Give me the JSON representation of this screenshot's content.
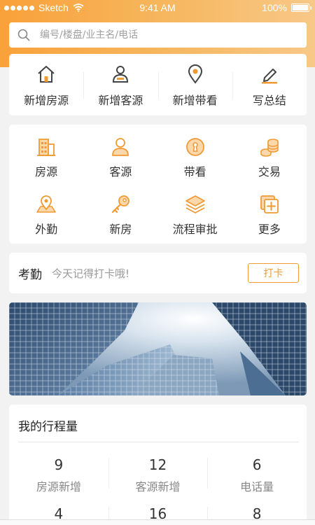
{
  "status_bar": {
    "carrier": "Sketch",
    "time": "9:41 AM",
    "battery": "100%"
  },
  "search": {
    "placeholder": "编号/楼盘/业主名/电话"
  },
  "quick_actions": [
    {
      "label": "新增房源",
      "icon": "house-icon"
    },
    {
      "label": "新增客源",
      "icon": "user-card-icon"
    },
    {
      "label": "新增带看",
      "icon": "location-pin-icon"
    },
    {
      "label": "写总结",
      "icon": "pencil-icon"
    }
  ],
  "grid": [
    {
      "label": "房源",
      "icon": "building-icon"
    },
    {
      "label": "客源",
      "icon": "person-icon"
    },
    {
      "label": "带看",
      "icon": "keyhole-icon"
    },
    {
      "label": "交易",
      "icon": "coins-icon"
    },
    {
      "label": "外勤",
      "icon": "map-pin-icon"
    },
    {
      "label": "新房",
      "icon": "key-icon"
    },
    {
      "label": "流程审批",
      "icon": "layers-icon"
    },
    {
      "label": "更多",
      "icon": "more-plus-icon"
    }
  ],
  "attendance": {
    "title": "考勤",
    "tip": "今天记得打卡哦!",
    "button": "打卡"
  },
  "itinerary": {
    "title": "我的行程量",
    "stats": [
      {
        "value": "9",
        "label": "房源新增"
      },
      {
        "value": "12",
        "label": "客源新增"
      },
      {
        "value": "6",
        "label": "电话量"
      },
      {
        "value": "4",
        "label": ""
      },
      {
        "value": "16",
        "label": ""
      },
      {
        "value": "8",
        "label": ""
      }
    ]
  },
  "colors": {
    "accent": "#f09a33",
    "header_start": "#f9a13a",
    "header_end": "#f8c888"
  }
}
